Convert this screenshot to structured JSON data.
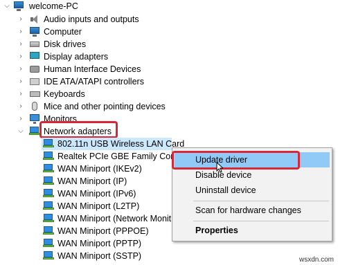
{
  "tree": {
    "root": "welcome-PC",
    "categories": [
      {
        "label": "Audio inputs and outputs",
        "icon": "speaker-icon"
      },
      {
        "label": "Computer",
        "icon": "computer-icon"
      },
      {
        "label": "Disk drives",
        "icon": "disk-drive-icon"
      },
      {
        "label": "Display adapters",
        "icon": "display-adapter-icon"
      },
      {
        "label": "Human Interface Devices",
        "icon": "hid-icon"
      },
      {
        "label": "IDE ATA/ATAPI controllers",
        "icon": "ide-controller-icon"
      },
      {
        "label": "Keyboards",
        "icon": "keyboard-icon"
      },
      {
        "label": "Mice and other pointing devices",
        "icon": "mouse-icon"
      },
      {
        "label": "Monitors",
        "icon": "monitor-icon"
      },
      {
        "label": "Network adapters",
        "icon": "network-adapter-icon"
      }
    ],
    "network_adapters": [
      "802.11n USB Wireless LAN Card",
      "Realtek PCIe GBE Family Contro",
      "WAN Miniport (IKEv2)",
      "WAN Miniport (IP)",
      "WAN Miniport (IPv6)",
      "WAN Miniport (L2TP)",
      "WAN Miniport (Network Monit",
      "WAN Miniport (PPPOE)",
      "WAN Miniport (PPTP)",
      "WAN Miniport (SSTP)"
    ]
  },
  "context_menu": {
    "update_driver": "Update driver",
    "disable_device": "Disable device",
    "uninstall_device": "Uninstall device",
    "scan_hardware": "Scan for hardware changes",
    "properties": "Properties"
  },
  "watermark": "wsxdn.com",
  "colors": {
    "highlight_border": "#d9273a",
    "selection": "#cce8ff",
    "menu_hover": "#91c9f7"
  }
}
